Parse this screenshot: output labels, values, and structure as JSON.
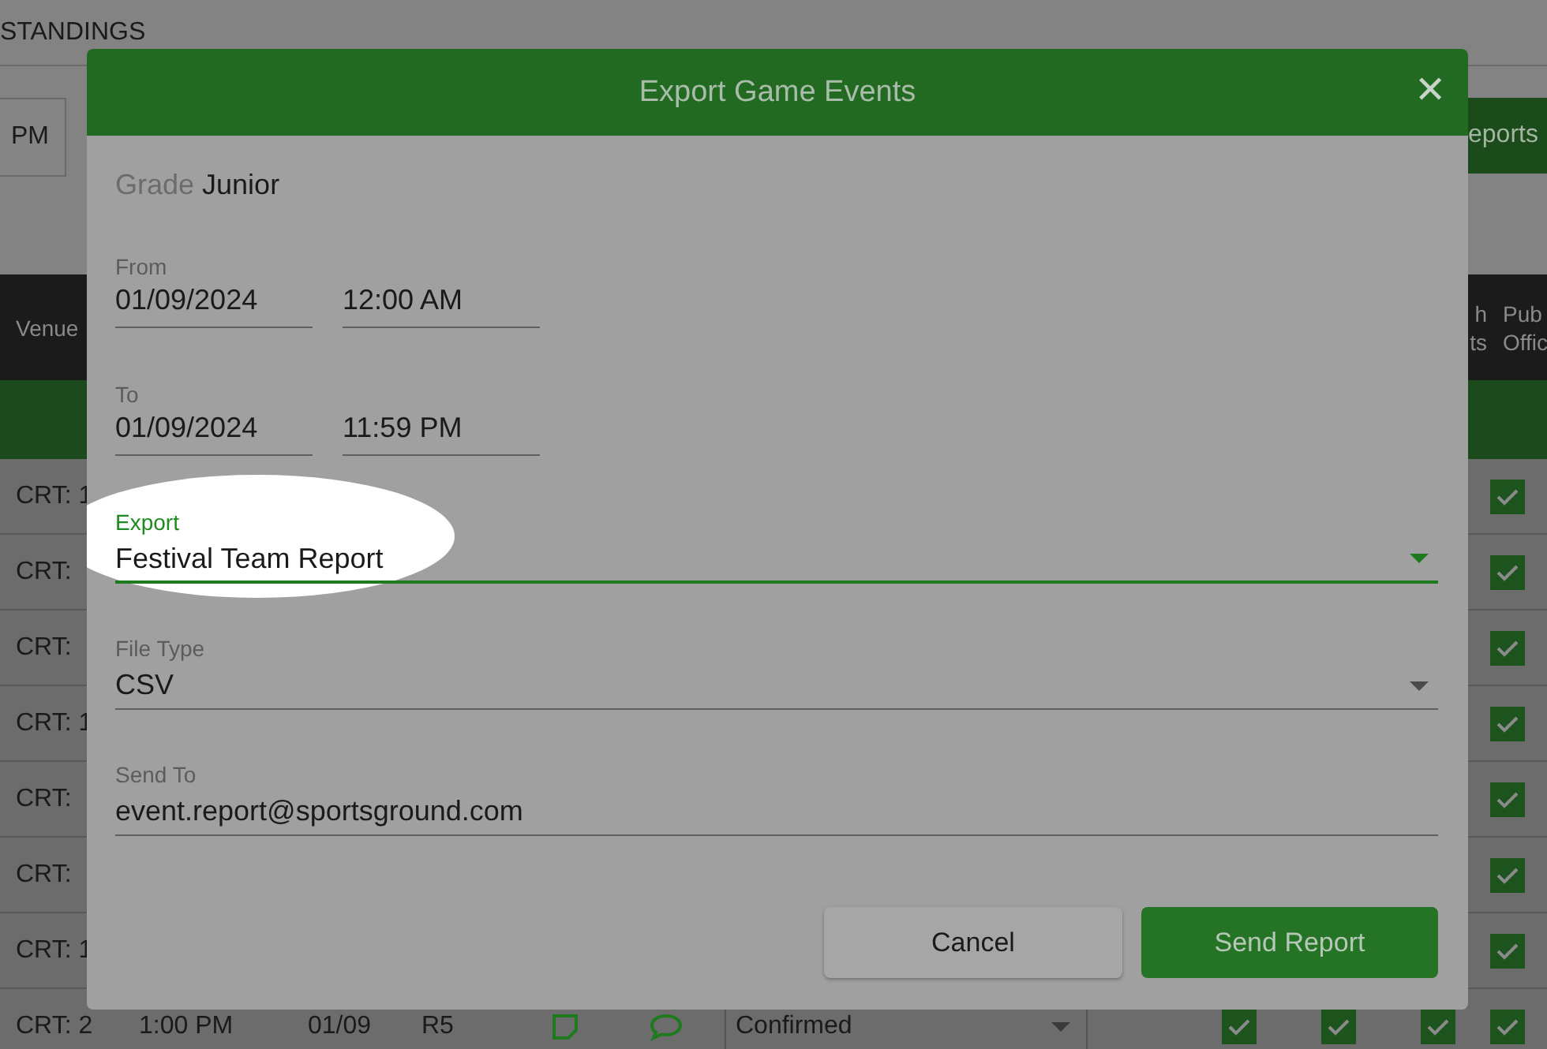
{
  "page": {
    "title": "STANDINGS",
    "toolbar_button": "PM",
    "reports_button": "eports"
  },
  "table": {
    "header": {
      "venue": "Venue",
      "column_2": [
        "h",
        "ts"
      ],
      "column_3": [
        "Pub",
        "Offic"
      ]
    },
    "rows": [
      {
        "venue": "CRT: 1",
        "checks": [
          true
        ]
      },
      {
        "venue": "CRT:",
        "checks": [
          true
        ]
      },
      {
        "venue": "CRT:",
        "checks": [
          true
        ]
      },
      {
        "venue": "CRT: 1",
        "checks": [
          true
        ]
      },
      {
        "venue": "CRT:",
        "checks": [
          true
        ]
      },
      {
        "venue": "CRT:",
        "checks": [
          true
        ]
      },
      {
        "venue": "CRT: 1",
        "checks": [
          true
        ]
      },
      {
        "venue": "CRT: 2",
        "time": "1:00 PM",
        "date": "01/09",
        "round": "R5",
        "status": "Confirmed",
        "checks": [
          true,
          true,
          true,
          true
        ]
      }
    ]
  },
  "dialog": {
    "title": "Export Game Events",
    "close": "✕",
    "grade_label": "Grade",
    "grade": "Junior",
    "from": {
      "label": "From",
      "date": "01/09/2024",
      "time": "12:00 AM"
    },
    "to": {
      "label": "To",
      "date": "01/09/2024",
      "time": "11:59 PM"
    },
    "fields": [
      {
        "kind": "select",
        "label": "Export",
        "value": "Festival Team Report",
        "focused": true
      },
      {
        "kind": "select",
        "label": "File Type",
        "value": "CSV",
        "focused": false
      },
      {
        "kind": "text",
        "label": "Send To",
        "value": "event.report@sportsground.com",
        "focused": false
      }
    ],
    "buttons": [
      {
        "label": "Cancel",
        "primary": false
      },
      {
        "label": "Send Report",
        "primary": true
      }
    ]
  }
}
